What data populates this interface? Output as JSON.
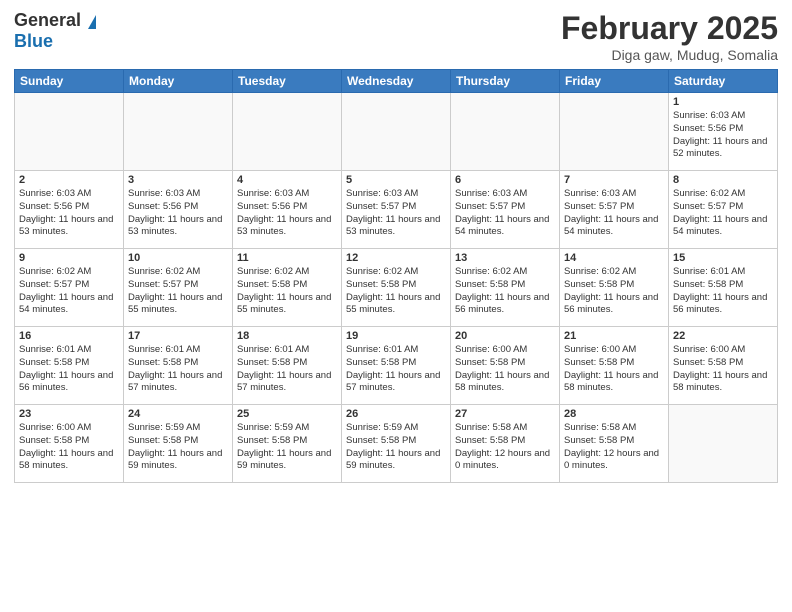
{
  "header": {
    "logo_general": "General",
    "logo_blue": "Blue",
    "month_title": "February 2025",
    "subtitle": "Diga gaw, Mudug, Somalia"
  },
  "days_of_week": [
    "Sunday",
    "Monday",
    "Tuesday",
    "Wednesday",
    "Thursday",
    "Friday",
    "Saturday"
  ],
  "weeks": [
    [
      {
        "day": "",
        "info": ""
      },
      {
        "day": "",
        "info": ""
      },
      {
        "day": "",
        "info": ""
      },
      {
        "day": "",
        "info": ""
      },
      {
        "day": "",
        "info": ""
      },
      {
        "day": "",
        "info": ""
      },
      {
        "day": "1",
        "info": "Sunrise: 6:03 AM\nSunset: 5:56 PM\nDaylight: 11 hours and 52 minutes."
      }
    ],
    [
      {
        "day": "2",
        "info": "Sunrise: 6:03 AM\nSunset: 5:56 PM\nDaylight: 11 hours and 53 minutes."
      },
      {
        "day": "3",
        "info": "Sunrise: 6:03 AM\nSunset: 5:56 PM\nDaylight: 11 hours and 53 minutes."
      },
      {
        "day": "4",
        "info": "Sunrise: 6:03 AM\nSunset: 5:56 PM\nDaylight: 11 hours and 53 minutes."
      },
      {
        "day": "5",
        "info": "Sunrise: 6:03 AM\nSunset: 5:57 PM\nDaylight: 11 hours and 53 minutes."
      },
      {
        "day": "6",
        "info": "Sunrise: 6:03 AM\nSunset: 5:57 PM\nDaylight: 11 hours and 54 minutes."
      },
      {
        "day": "7",
        "info": "Sunrise: 6:03 AM\nSunset: 5:57 PM\nDaylight: 11 hours and 54 minutes."
      },
      {
        "day": "8",
        "info": "Sunrise: 6:02 AM\nSunset: 5:57 PM\nDaylight: 11 hours and 54 minutes."
      }
    ],
    [
      {
        "day": "9",
        "info": "Sunrise: 6:02 AM\nSunset: 5:57 PM\nDaylight: 11 hours and 54 minutes."
      },
      {
        "day": "10",
        "info": "Sunrise: 6:02 AM\nSunset: 5:57 PM\nDaylight: 11 hours and 55 minutes."
      },
      {
        "day": "11",
        "info": "Sunrise: 6:02 AM\nSunset: 5:58 PM\nDaylight: 11 hours and 55 minutes."
      },
      {
        "day": "12",
        "info": "Sunrise: 6:02 AM\nSunset: 5:58 PM\nDaylight: 11 hours and 55 minutes."
      },
      {
        "day": "13",
        "info": "Sunrise: 6:02 AM\nSunset: 5:58 PM\nDaylight: 11 hours and 56 minutes."
      },
      {
        "day": "14",
        "info": "Sunrise: 6:02 AM\nSunset: 5:58 PM\nDaylight: 11 hours and 56 minutes."
      },
      {
        "day": "15",
        "info": "Sunrise: 6:01 AM\nSunset: 5:58 PM\nDaylight: 11 hours and 56 minutes."
      }
    ],
    [
      {
        "day": "16",
        "info": "Sunrise: 6:01 AM\nSunset: 5:58 PM\nDaylight: 11 hours and 56 minutes."
      },
      {
        "day": "17",
        "info": "Sunrise: 6:01 AM\nSunset: 5:58 PM\nDaylight: 11 hours and 57 minutes."
      },
      {
        "day": "18",
        "info": "Sunrise: 6:01 AM\nSunset: 5:58 PM\nDaylight: 11 hours and 57 minutes."
      },
      {
        "day": "19",
        "info": "Sunrise: 6:01 AM\nSunset: 5:58 PM\nDaylight: 11 hours and 57 minutes."
      },
      {
        "day": "20",
        "info": "Sunrise: 6:00 AM\nSunset: 5:58 PM\nDaylight: 11 hours and 58 minutes."
      },
      {
        "day": "21",
        "info": "Sunrise: 6:00 AM\nSunset: 5:58 PM\nDaylight: 11 hours and 58 minutes."
      },
      {
        "day": "22",
        "info": "Sunrise: 6:00 AM\nSunset: 5:58 PM\nDaylight: 11 hours and 58 minutes."
      }
    ],
    [
      {
        "day": "23",
        "info": "Sunrise: 6:00 AM\nSunset: 5:58 PM\nDaylight: 11 hours and 58 minutes."
      },
      {
        "day": "24",
        "info": "Sunrise: 5:59 AM\nSunset: 5:58 PM\nDaylight: 11 hours and 59 minutes."
      },
      {
        "day": "25",
        "info": "Sunrise: 5:59 AM\nSunset: 5:58 PM\nDaylight: 11 hours and 59 minutes."
      },
      {
        "day": "26",
        "info": "Sunrise: 5:59 AM\nSunset: 5:58 PM\nDaylight: 11 hours and 59 minutes."
      },
      {
        "day": "27",
        "info": "Sunrise: 5:58 AM\nSunset: 5:58 PM\nDaylight: 12 hours and 0 minutes."
      },
      {
        "day": "28",
        "info": "Sunrise: 5:58 AM\nSunset: 5:58 PM\nDaylight: 12 hours and 0 minutes."
      },
      {
        "day": "",
        "info": ""
      }
    ]
  ]
}
